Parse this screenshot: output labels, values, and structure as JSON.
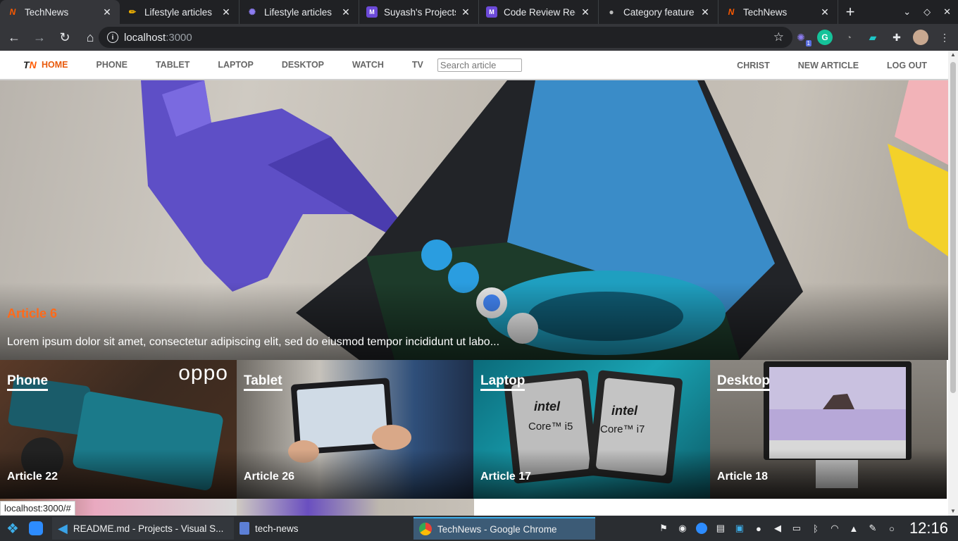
{
  "browser": {
    "tabs": [
      {
        "title": "TechNews",
        "favicon": "technews-logo",
        "active": true
      },
      {
        "title": "Lifestyle articles",
        "favicon": "pencil-icon",
        "active": false
      },
      {
        "title": "Lifestyle articles",
        "favicon": "gear-icon",
        "active": false
      },
      {
        "title": "Suyash's Projects",
        "favicon": "monday-icon",
        "active": false
      },
      {
        "title": "Code Review Req",
        "favicon": "monday-icon",
        "active": false
      },
      {
        "title": "Category feature",
        "favicon": "github-icon",
        "active": false
      },
      {
        "title": "TechNews",
        "favicon": "technews-logo",
        "active": false
      }
    ],
    "new_tab": "+",
    "address": {
      "host": "localhost",
      "port": ":3000"
    },
    "extension_badge": "1"
  },
  "site": {
    "logo": "TN",
    "nav": [
      {
        "label": "HOME",
        "active": true
      },
      {
        "label": "PHONE"
      },
      {
        "label": "TABLET"
      },
      {
        "label": "LAPTOP"
      },
      {
        "label": "DESKTOP"
      },
      {
        "label": "WATCH"
      },
      {
        "label": "TV"
      }
    ],
    "search_placeholder": "Search article",
    "nav_right": [
      "CHRIST",
      "NEW ARTICLE",
      "LOG OUT"
    ],
    "hero": {
      "title": "Article 6",
      "excerpt": "Lorem ipsum dolor sit amet, consectetur adipiscing elit, sed do eiusmod tempor incididunt ut labo..."
    },
    "cards": [
      {
        "category": "Phone",
        "title": "Article 22",
        "image_text": "oppo"
      },
      {
        "category": "Tablet",
        "title": "Article 26"
      },
      {
        "category": "Laptop",
        "title": "Article 17",
        "chip1": "intel",
        "chip1_sub": "Core™ i5",
        "chip2": "intel",
        "chip2_sub": "Core™ i7"
      },
      {
        "category": "Desktop",
        "title": "Article 18"
      }
    ],
    "status_url": "localhost:3000/#"
  },
  "taskbar": {
    "tasks": [
      {
        "label": "README.md - Projects - Visual S...",
        "app": "vscode-icon",
        "active": false
      },
      {
        "label": "tech-news",
        "app": "file-manager-icon",
        "active": false
      },
      {
        "label": "TechNews - Google Chrome",
        "app": "chrome-icon",
        "active": true
      }
    ],
    "clock": "12:16"
  },
  "colors": {
    "accent": "#ff5a00",
    "chrome_bg": "#202124",
    "toolbar_bg": "#35363a",
    "taskbar_bg": "#2a2d31"
  }
}
